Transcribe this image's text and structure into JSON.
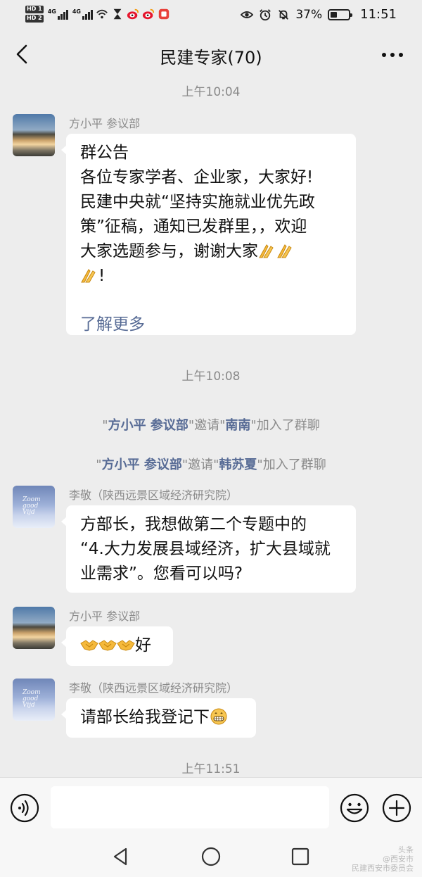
{
  "status_bar": {
    "hd1": "HD 1",
    "hd2": "HD 2",
    "net1": "4G",
    "net2": "4G",
    "battery_percent": "37%",
    "battery_level": 0.37,
    "time": "11:51",
    "icons": [
      "wifi-icon",
      "hourglass-icon",
      "weibo-icon",
      "weibo-icon",
      "app-icon",
      "eye-icon",
      "alarm-icon",
      "mute-icon",
      "battery-icon"
    ]
  },
  "header": {
    "title": "民建专家(70)"
  },
  "chat": {
    "time1": "上午10:04",
    "msg1": {
      "sender": "方小平 参议部",
      "lines": [
        "群公告",
        "各位专家学者、企业家，大家好!",
        "民建中央就“坚持实施就业优先政",
        "策”征稿，通知已发群里，，欢迎",
        "大家选题参与，谢谢大家",
        "!"
      ],
      "link": "了解更多"
    },
    "time2": "上午10:08",
    "sys1": {
      "q1": "\"",
      "name1": "方小平 参议部",
      "mid": "\"邀请\"",
      "name2": "南南",
      "tail": "\"加入了群聊"
    },
    "sys2": {
      "q1": "\"",
      "name1": "方小平 参议部",
      "mid": "\"邀请\"",
      "name2": "韩苏夏",
      "tail": "\"加入了群聊"
    },
    "msg2": {
      "sender": "李敬（陕西远景区域经济研究院）",
      "lines": [
        "方部长，我想做第二个专题中的",
        "“4.大力发展县域经济，扩大县域就",
        "业需求”。您看可以吗?"
      ]
    },
    "msg3": {
      "sender": "方小平 参议部",
      "text": "好"
    },
    "msg4": {
      "sender": "李敬（陕西远景区域经济研究院）",
      "text": "请部长给我登记下"
    },
    "time3": "上午11:51"
  },
  "avatar_text": [
    "Zoom",
    "good",
    "Vijd"
  ],
  "watermark": [
    "头条",
    "@西安市",
    "民建西安市委员会"
  ]
}
